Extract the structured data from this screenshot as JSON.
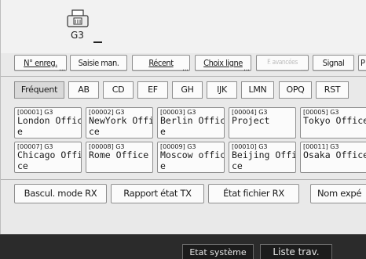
{
  "line": {
    "label": "G3"
  },
  "function_buttons": [
    {
      "label": "N° enreg."
    },
    {
      "label": "Saisie man."
    },
    {
      "label": "Récent"
    },
    {
      "label": "Choix ligne"
    },
    {
      "label": "F. avancées"
    },
    {
      "label": "Signal"
    },
    {
      "label": "P"
    }
  ],
  "tabs": [
    {
      "label": "Fréquent"
    },
    {
      "label": "AB"
    },
    {
      "label": "CD"
    },
    {
      "label": "EF"
    },
    {
      "label": "GH"
    },
    {
      "label": "IJK"
    },
    {
      "label": "LMN"
    },
    {
      "label": "OPQ"
    },
    {
      "label": "RST"
    }
  ],
  "entries": [
    {
      "code": "[00001] G3",
      "name": "London Office"
    },
    {
      "code": "[00002] G3",
      "name": "NewYork Office"
    },
    {
      "code": "[00003] G3",
      "name": "Berlin Office"
    },
    {
      "code": "[00004] G3",
      "name": "Project"
    },
    {
      "code": "[00005] G3",
      "name": "Tokyo Office"
    },
    {
      "code": "[00007] G3",
      "name": "Chicago Office"
    },
    {
      "code": "[00008] G3",
      "name": "Rome Office"
    },
    {
      "code": "[00009] G3",
      "name": "Moscow office"
    },
    {
      "code": "[00010] G3",
      "name": "Beijing Office"
    },
    {
      "code": "[00011] G3",
      "name": "Osaka Office"
    }
  ],
  "bottom_buttons": [
    {
      "label": "Bascul. mode RX"
    },
    {
      "label": "Rapport état TX"
    },
    {
      "label": "État fichier RX"
    },
    {
      "label": "Nom expé"
    }
  ],
  "status_bar": {
    "system_status": "Etat système",
    "job_list": "Liste trav."
  }
}
